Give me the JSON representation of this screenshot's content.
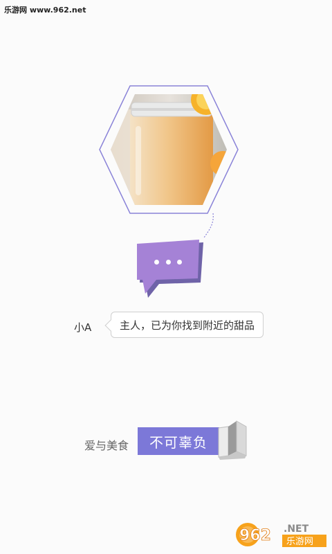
{
  "watermark": {
    "text": "乐游网 www.962.net"
  },
  "hero": {
    "image_icon": "orange-smoothie-jar",
    "accent_color": "#8a83d8",
    "bubble_color": "#a582d6",
    "bubble_icon": "ellipsis-icon"
  },
  "chat": {
    "sender": "小A",
    "message": "主人，已为你找到附近的甜品"
  },
  "slogan": {
    "left": "爱与美食",
    "highlight": "不可辜负",
    "highlight_color": "#7c78d8",
    "book_icon": "open-book-icon"
  },
  "brand": {
    "logo_text": "962",
    "net_text": ".NET",
    "cn_text": "乐游网"
  }
}
